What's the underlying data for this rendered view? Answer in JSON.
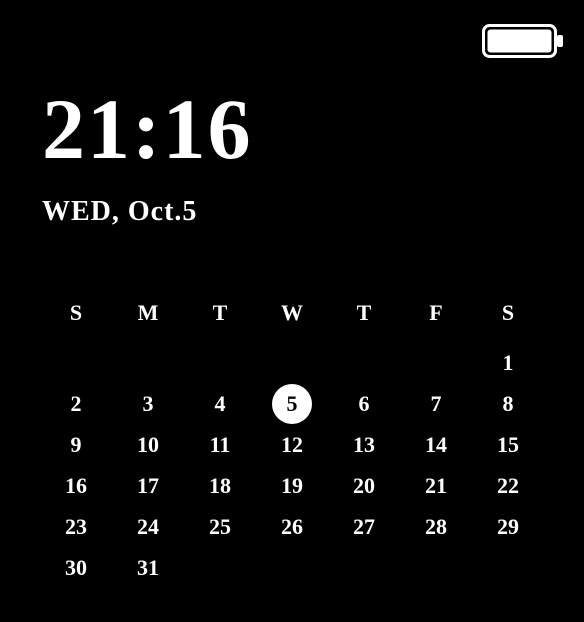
{
  "status": {
    "battery_level": 100
  },
  "clock": {
    "time": "21:16",
    "date": "WED, Oct.5"
  },
  "calendar": {
    "headers": [
      "S",
      "M",
      "T",
      "W",
      "T",
      "F",
      "S"
    ],
    "today": 5,
    "weeks": [
      [
        "",
        "",
        "",
        "",
        "",
        "",
        "1"
      ],
      [
        "2",
        "3",
        "4",
        "5",
        "6",
        "7",
        "8"
      ],
      [
        "9",
        "10",
        "11",
        "12",
        "13",
        "14",
        "15"
      ],
      [
        "16",
        "17",
        "18",
        "19",
        "20",
        "21",
        "22"
      ],
      [
        "23",
        "24",
        "25",
        "26",
        "27",
        "28",
        "29"
      ],
      [
        "30",
        "31",
        "",
        "",
        "",
        "",
        ""
      ]
    ]
  }
}
